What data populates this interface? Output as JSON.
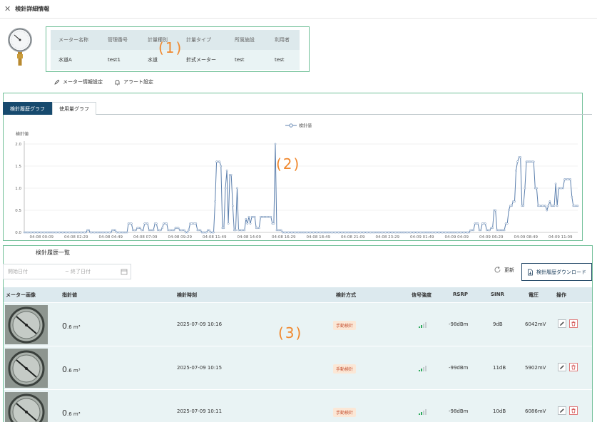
{
  "header": {
    "close_icon": "close-icon",
    "title": "検針詳細情報"
  },
  "meter_info": {
    "columns": [
      "メーター名称",
      "管理番号",
      "計量種別",
      "計量タイプ",
      "所属施設",
      "利用者"
    ],
    "values": [
      "水道A",
      "test1",
      "水道",
      "針式メーター",
      "test",
      "test"
    ]
  },
  "markers": {
    "m1": "(1)",
    "m2": "(2)",
    "m3": "(3)"
  },
  "actions": {
    "edit": "メーター情報設定",
    "alert": "アラート設定"
  },
  "tabs": [
    {
      "label": "検針履歴グラフ",
      "active": true
    },
    {
      "label": "使用量グラフ",
      "active": false
    }
  ],
  "chart_data": {
    "type": "line",
    "legend": "検針値",
    "ylabel": "検針値",
    "ylim": [
      0,
      2.0
    ],
    "yticks": [
      "0.0",
      "0.5",
      "1.0",
      "1.5",
      "2.0"
    ],
    "xticks": [
      "04-08 00:09",
      "04-08 02:29",
      "04-08 04:49",
      "04-08 07:09",
      "04-08 09:29",
      "04-08 11:49",
      "04-08 14:09",
      "04-08 16:29",
      "04-08 18:49",
      "04-08 21:09",
      "04-08 23:29",
      "04-09 01:49",
      "04-09 04:09",
      "04-09 06:29",
      "04-09 08:49",
      "04-09 11:09"
    ],
    "series": [
      {
        "color": "#5b7fad",
        "values": [
          0,
          0,
          0,
          0,
          0,
          0,
          0,
          0,
          0,
          0,
          0,
          0,
          0,
          0,
          0,
          0,
          0,
          0,
          0,
          0,
          0,
          0,
          0,
          0,
          0,
          0,
          0,
          0,
          0,
          0,
          0,
          0,
          0,
          0,
          0,
          0,
          0,
          0,
          0,
          0,
          0,
          0,
          0,
          0.05,
          0.05,
          0,
          0,
          0,
          0,
          0,
          0,
          0,
          0,
          0,
          0,
          0,
          0,
          0,
          0,
          0,
          0.05,
          0.05,
          0.05,
          0,
          0,
          0,
          0,
          0,
          0,
          0,
          0,
          0.2,
          0.2,
          0.2,
          0.05,
          0.05,
          0.05,
          0.1,
          0.1,
          0.1,
          0.05,
          0.05,
          0.2,
          0.2,
          0.2,
          0.05,
          0.05,
          0.05,
          0.05,
          0.2,
          0.2,
          0.05,
          0.05,
          0.05,
          0.1,
          0.2,
          0.2,
          0.2,
          0.05,
          0.05,
          0.05,
          0.05,
          0.05,
          0.1,
          0.1,
          0.1,
          0.05,
          0.05,
          0.05,
          0.05,
          0,
          0,
          0.05,
          0.2,
          0.2,
          0.2,
          0.2,
          0.2,
          0.05,
          0.05,
          0.05,
          0,
          0,
          0,
          0,
          0.05,
          0.05,
          0,
          0,
          0,
          0.7,
          1.6,
          1.6,
          1.6,
          1.5,
          0.1,
          0.1,
          1.0,
          1.4,
          0.2,
          1.3,
          1.3,
          0.6,
          0.05,
          0.05,
          1.0,
          0.05,
          0.05,
          0.05,
          0.05,
          0.05,
          0.3,
          0.2,
          0.35,
          0.2,
          0.35,
          0.35,
          0.35,
          0.1,
          0.1,
          0.1,
          0.35,
          0.35,
          0.35,
          0.35,
          0.35,
          0.35,
          0.35,
          0.35,
          0.2,
          0.2,
          2.0,
          0.05,
          0.05,
          0.05,
          0.05,
          0,
          0,
          0,
          0,
          0,
          0,
          0,
          0,
          0,
          0,
          0,
          0,
          0,
          0,
          0,
          0,
          0,
          0,
          0,
          0,
          0,
          0,
          0,
          0,
          0,
          0,
          0,
          0,
          0,
          0,
          0,
          0,
          0,
          0,
          0,
          0,
          0,
          0,
          0,
          0,
          0,
          0,
          0,
          0,
          0,
          0,
          0,
          0,
          0,
          0,
          0,
          0,
          0,
          0,
          0,
          0,
          0,
          0,
          0,
          0,
          0,
          0,
          0,
          0,
          0,
          0,
          0,
          0,
          0,
          0,
          0,
          0,
          0,
          0,
          0,
          0,
          0,
          0,
          0,
          0,
          0,
          0,
          0,
          0,
          0,
          0,
          0,
          0,
          0,
          0,
          0,
          0,
          0,
          0,
          0,
          0,
          0,
          0,
          0,
          0,
          0,
          0,
          0,
          0,
          0,
          0,
          0,
          0,
          0,
          0,
          0,
          0,
          0,
          0,
          0,
          0,
          0,
          0,
          0,
          0,
          0,
          0,
          0,
          0,
          0,
          0,
          0,
          0,
          0.05,
          0.05,
          0.05,
          0.2,
          0.2,
          0.2,
          0.05,
          0.05,
          0.2,
          0.2,
          0.2,
          0.05,
          0.05,
          0.05,
          0.1,
          0.1,
          0.5,
          0.5,
          0.05,
          0.05,
          0.05,
          0.05,
          0.05,
          0.05,
          0.2,
          0.2,
          0.5,
          0.6,
          0.6,
          0.7,
          0.7,
          1.4,
          1.6,
          1.7,
          1.7,
          0.6,
          0.6,
          1.0,
          1.6,
          1.6,
          1.6,
          1.6,
          1.6,
          1.6,
          1.0,
          1.0,
          0.6,
          0.6,
          0.6,
          0.6,
          0.6,
          0.6,
          0.5,
          0.6,
          0.7,
          0.6,
          0.6,
          0.6,
          1.1,
          0.6,
          1.0,
          1.0,
          1.0,
          1.0,
          1.2,
          1.2,
          1.2,
          1.2,
          1.2,
          0.8,
          0.6,
          0.6,
          0.6,
          0.6
        ]
      }
    ],
    "grid": true,
    "legend_position": "top-center"
  },
  "list": {
    "title": "検針履歴一覧",
    "date_start_placeholder": "開始日付",
    "date_sep": "~",
    "date_end_placeholder": "終了日付",
    "refresh_label": "更新",
    "download_label": "検針履歴ダウンロード",
    "headers": [
      "メーター画像",
      "指針値",
      "検針時刻",
      "検針方式",
      "信号強度",
      "RSRP",
      "SINR",
      "電圧",
      "操作"
    ],
    "rows": [
      {
        "value_big": "0",
        "value_small": ".6 m³",
        "time": "2025-07-09 10:16",
        "method": "手動検針",
        "signal": 2,
        "rsrp": "-98dBm",
        "sinr": "9dB",
        "voltage": "6042mV"
      },
      {
        "value_big": "0",
        "value_small": ".6 m³",
        "time": "2025-07-09 10:15",
        "method": "手動検針",
        "signal": 2,
        "rsrp": "-99dBm",
        "sinr": "11dB",
        "voltage": "5902mV"
      },
      {
        "value_big": "0",
        "value_small": ".6 m³",
        "time": "2025-07-09 10:11",
        "method": "手動検針",
        "signal": 2,
        "rsrp": "-98dBm",
        "sinr": "10dB",
        "voltage": "6086mV"
      }
    ]
  }
}
